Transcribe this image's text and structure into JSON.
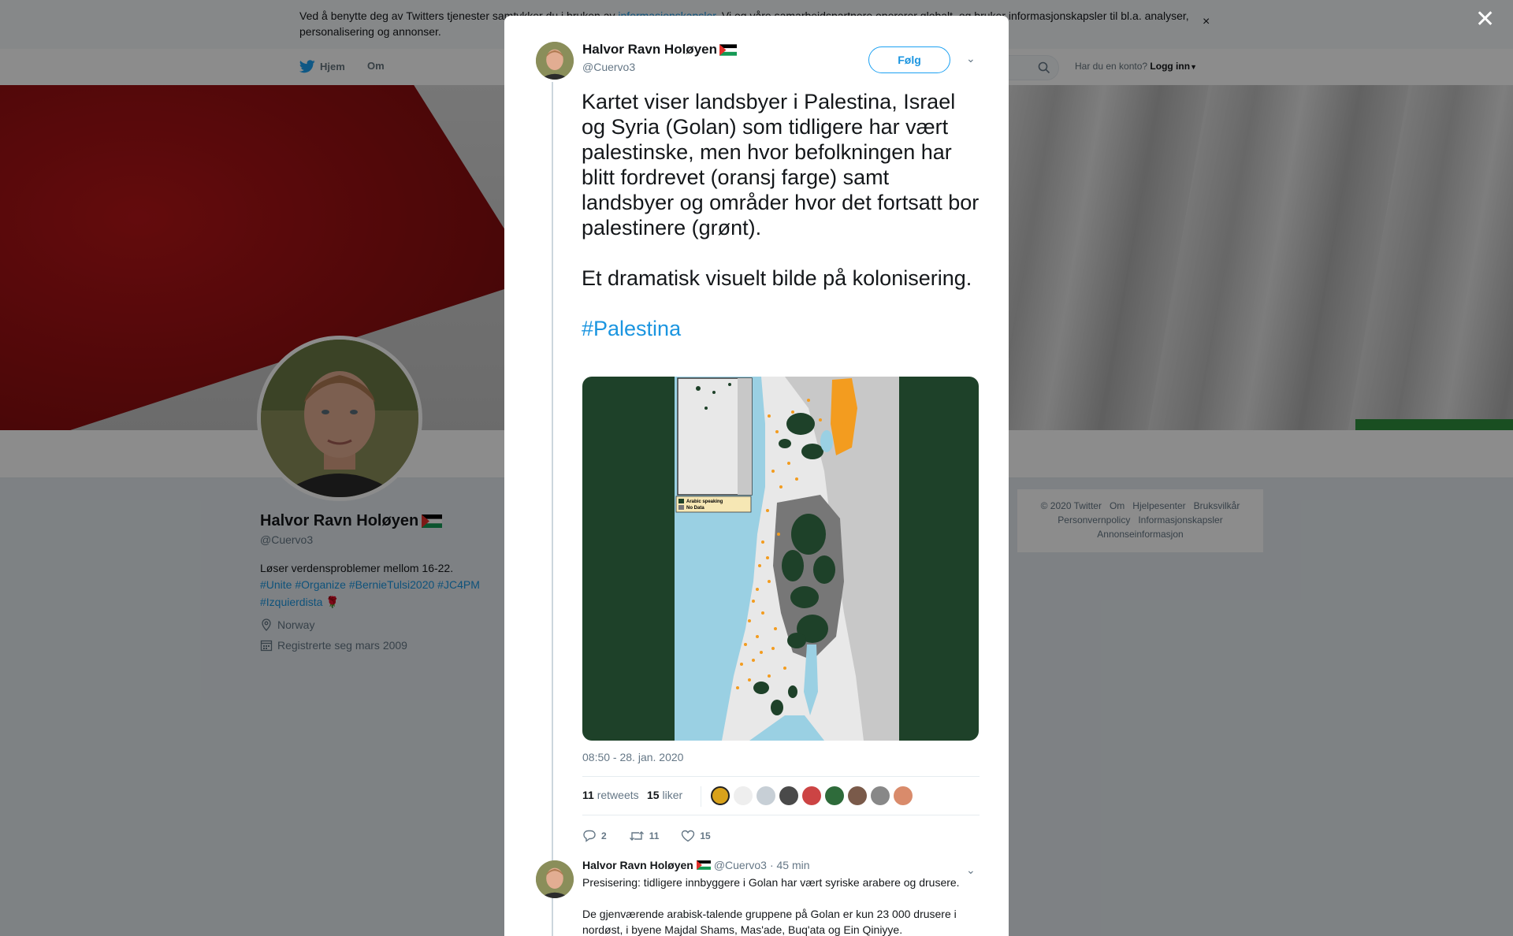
{
  "cookie_banner": {
    "text": "Ved å benytte deg av Twitters tjenester samtykker du i bruken av ",
    "link": "informasjonskapsler",
    "text_after": ". Vi og våre samarbeidspartnere opererer globalt, og bruker informasjonskapsler til bl.a. analyser, personalisering og annonser.",
    "close": "×"
  },
  "nav": {
    "home": "Hjem",
    "about": "Om",
    "login_prompt": "Har du en konto?",
    "login": "Logg inn"
  },
  "profile": {
    "name": "Halvor Ravn Holøyen",
    "handle": "@Cuervo3",
    "bio": "Løser verdensproblemer mellom 16-22.",
    "tags_line1": "#Unite #Organize #BernieTulsi2020 #JC4PM",
    "tags_line2": "#Izquierdista",
    "location": "Norway",
    "joined": "Registrerte seg mars 2009"
  },
  "footer": {
    "row1": [
      "© 2020 Twitter",
      "Om",
      "Hjelpesenter",
      "Bruksvilkår"
    ],
    "row2": [
      "Personvernpolicy",
      "Informasjonskapsler"
    ],
    "row3": [
      "Annonseinformasjon"
    ]
  },
  "overlay": {
    "close": "✕"
  },
  "tweet": {
    "author_name": "Halvor Ravn Holøyen",
    "author_handle": "@Cuervo3",
    "follow": "Følg",
    "text": "Kartet viser landsbyer i Palestina, Israel og Syria (Golan) som tidligere har vært palestinske, men hvor befolkningen har blitt fordrevet (oransj farge) samt landsbyer og områder hvor det fortsatt bor palestinere (grønt).\n\nEt dramatisk visuelt bilde på kolonisering.\n\n",
    "hashtag": "#Palestina",
    "map_legend_1": "Arabic speaking",
    "map_legend_2": "No Data",
    "timestamp": "08:50 - 28. jan. 2020",
    "retweets_count": "11",
    "retweets_label": "retweets",
    "likes_count": "15",
    "likes_label": "liker",
    "reply_count": "2",
    "retweet_count": "11",
    "like_count": "15"
  },
  "reply": {
    "name": "Halvor Ravn Holøyen",
    "handle": "@Cuervo3",
    "time": "· 45 min",
    "text": "Presisering: tidligere innbyggere i Golan har vært syriske arabere og drusere.\n\nDe gjenværende arabisk-talende gruppene på Golan er kun 23 000 drusere i nordøst, i byene Majdal Shams, Mas'ade, Buq'ata og Ein Qiniyye."
  },
  "colors": {
    "link": "#1b95e0",
    "map_green": "#1e4129",
    "map_orange": "#f39c1f",
    "map_sea": "#9ad0e3"
  }
}
